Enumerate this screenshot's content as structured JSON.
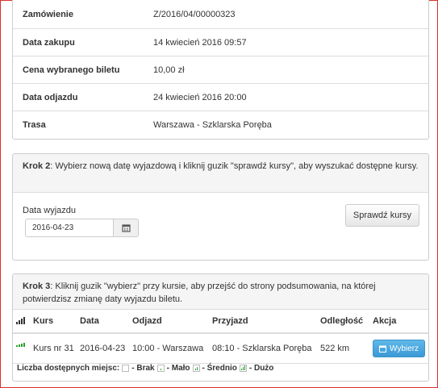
{
  "order": {
    "rows": [
      {
        "label": "Zamówienie",
        "value": "Z/2016/04/00000323"
      },
      {
        "label": "Data zakupu",
        "value": "14 kwiecień 2016 09:57"
      },
      {
        "label": "Cena wybranego biletu",
        "value": "10,00 zł"
      },
      {
        "label": "Data odjazdu",
        "value": "24 kwiecień 2016 20:00"
      },
      {
        "label": "Trasa",
        "value": "Warszawa - Szklarska Poręba"
      }
    ]
  },
  "step2": {
    "step": "Krok 2",
    "text": ": Wybierz nową datę wyjazdową i kliknij guzik \"sprawdź kursy\", aby wyszukać dostępne kursy.",
    "date_label": "Data wyjazdu",
    "date_value": "2016-04-23",
    "check_button": "Sprawdź kursy",
    "calendar_icon": "calendar-icon"
  },
  "step3": {
    "step": "Krok 3",
    "text": ": Kliknij guzik \"wybierz\" przy kursie, aby przejść do strony podsumowania, na której potwierdzisz zmianę daty wyjazdu biletu.",
    "headers": {
      "course": "Kurs",
      "date": "Data",
      "departure": "Odjazd",
      "arrival": "Przyjazd",
      "distance": "Odległość",
      "action": "Akcja"
    },
    "rows": [
      {
        "course": "Kurs nr 31",
        "date": "2016-04-23",
        "departure": "10:00 - Warszawa",
        "arrival": "08:10 - Szklarska Poręba",
        "distance": "522 km",
        "action": "Wybierz",
        "availability": 4
      }
    ],
    "legend": {
      "title": "Liczba dostępnych miejsc:",
      "none": "- Brak",
      "few": "- Mało",
      "medium": "- Średnio",
      "many": "- Dużo"
    }
  },
  "colors": {
    "accent": "#3a9ad6",
    "availability": "#2aa02a",
    "border": "#d9302c"
  }
}
